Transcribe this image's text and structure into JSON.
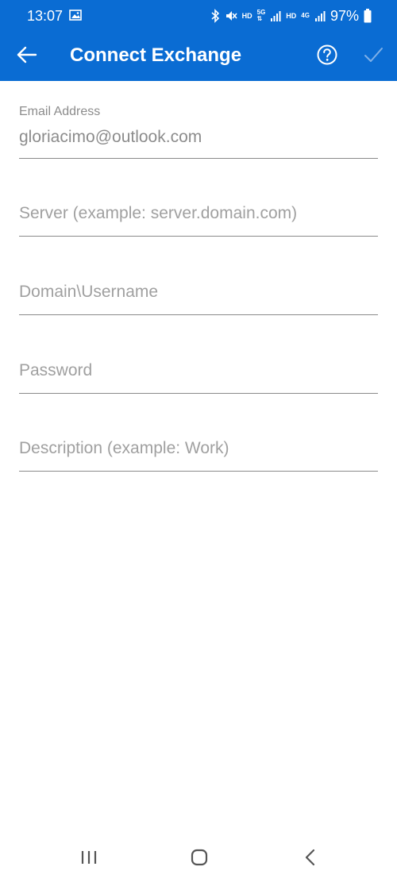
{
  "status_bar": {
    "time": "13:07",
    "network_hd_1": "HD",
    "network_5g": "5G",
    "network_hd_2": "HD",
    "network_4g": "4G",
    "battery_percent": "97%",
    "icons": [
      "image-icon",
      "bluetooth-icon",
      "mute-icon",
      "signal-icon",
      "battery-icon"
    ]
  },
  "app_bar": {
    "title": "Connect Exchange",
    "back_icon": "arrow-left-icon",
    "help_icon": "question-circle-icon",
    "confirm_icon": "checkmark-icon"
  },
  "form": {
    "email": {
      "label": "Email Address",
      "value": "gloriacimo@outlook.com"
    },
    "server": {
      "placeholder": "Server (example: server.domain.com)"
    },
    "username": {
      "placeholder": "Domain\\Username"
    },
    "password": {
      "placeholder": "Password"
    },
    "description": {
      "placeholder": "Description (example: Work)"
    }
  },
  "colors": {
    "header_bg": "#0a6cd3",
    "text_gray": "#8c8c8c",
    "underline": "#8a8a8a",
    "nav_icon": "#555555"
  },
  "nav_bar": {
    "icons": [
      "recent-apps-icon",
      "home-icon",
      "back-icon"
    ]
  }
}
